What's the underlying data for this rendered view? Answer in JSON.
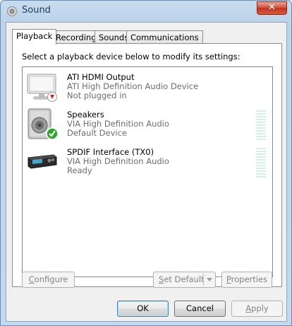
{
  "window": {
    "title": "Sound",
    "close_label": "✕"
  },
  "tabs": [
    {
      "label": "Playback",
      "active": true
    },
    {
      "label": "Recording",
      "active": false
    },
    {
      "label": "Sounds",
      "active": false
    },
    {
      "label": "Communications",
      "active": false
    }
  ],
  "instruction": "Select a playback device below to modify its settings:",
  "devices": [
    {
      "name": "ATI HDMI Output",
      "driver": "ATI High Definition Audio Device",
      "status": "Not plugged in",
      "icon": "monitor-icon",
      "badge": "red-down-arrow"
    },
    {
      "name": "Speakers",
      "driver": "VIA High Definition Audio",
      "status": "Default Device",
      "icon": "speaker-icon",
      "badge": "green-check",
      "level": 0
    },
    {
      "name": "SPDIF Interface (TX0)",
      "driver": "VIA High Definition Audio",
      "status": "Ready",
      "icon": "receiver-icon",
      "level": 0
    }
  ],
  "buttons": {
    "configure": {
      "pre": "",
      "accel": "C",
      "post": "onfigure"
    },
    "set_default": {
      "pre": "",
      "accel": "S",
      "post": "et Default"
    },
    "properties": {
      "pre": "",
      "accel": "P",
      "post": "roperties"
    },
    "ok": "OK",
    "cancel": "Cancel",
    "apply": {
      "pre": "",
      "accel": "A",
      "post": "pply"
    }
  }
}
